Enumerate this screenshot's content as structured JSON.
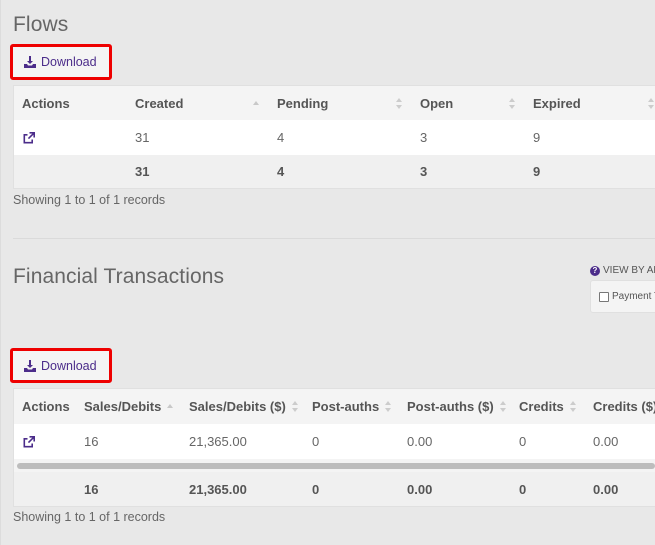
{
  "flows": {
    "title": "Flows",
    "download_label": "Download",
    "columns": [
      "Actions",
      "Created",
      "Pending",
      "Open",
      "Expired"
    ],
    "rows": [
      {
        "created": "31",
        "pending": "4",
        "open": "3",
        "expired": "9"
      }
    ],
    "totals": {
      "created": "31",
      "pending": "4",
      "open": "3",
      "expired": "9"
    },
    "showing": "Showing 1 to 1 of 1 records"
  },
  "financial": {
    "title": "Financial Transactions",
    "view_by_label": "VIEW BY AD",
    "filter_option": "Payment T",
    "download_label": "Download",
    "columns": [
      "Actions",
      "Sales/Debits",
      "Sales/Debits ($)",
      "Post-auths",
      "Post-auths ($)",
      "Credits",
      "Credits ($)"
    ],
    "rows": [
      {
        "sales": "16",
        "sales_amt": "21,365.00",
        "postauths": "0",
        "postauths_amt": "0.00",
        "credits": "0",
        "credits_amt": "0.00"
      }
    ],
    "totals": {
      "sales": "16",
      "sales_amt": "21,365.00",
      "postauths": "0",
      "postauths_amt": "0.00",
      "credits": "0",
      "credits_amt": "0.00"
    },
    "showing": "Showing 1 to 1 of 1 records"
  },
  "colors": {
    "accent": "#4b2c8a",
    "highlight": "#ee0000"
  }
}
